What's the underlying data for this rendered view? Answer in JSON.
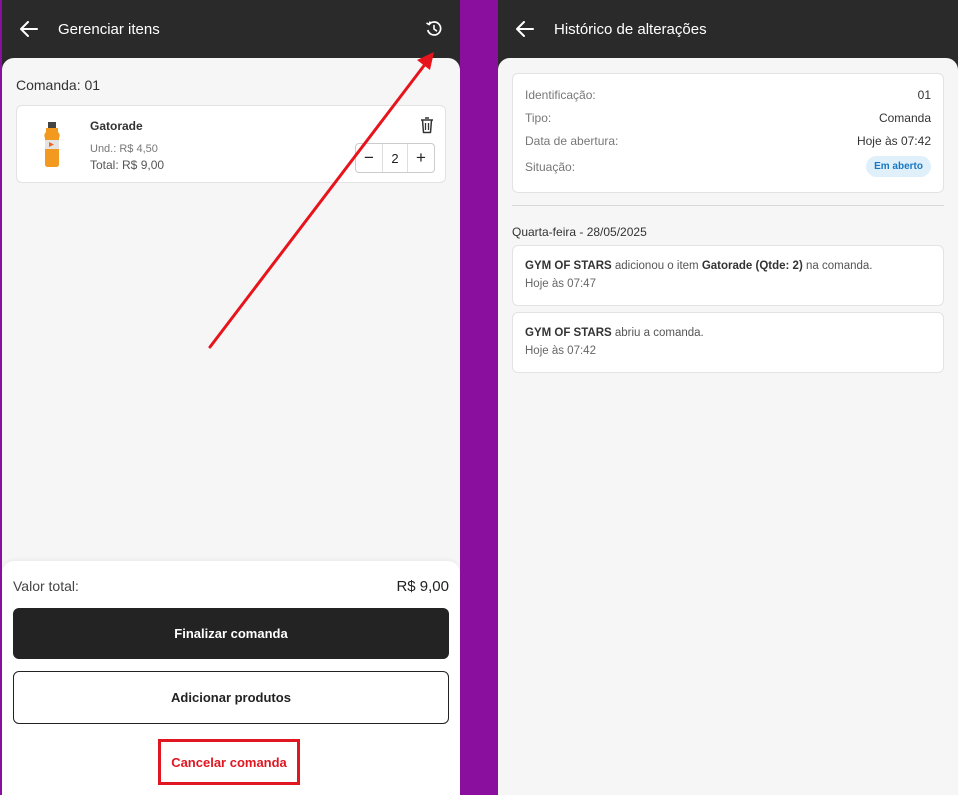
{
  "left": {
    "header": {
      "title": "Gerenciar itens"
    },
    "comanda_label": "Comanda: 01",
    "item": {
      "name": "Gatorade",
      "unit_price": "Und.: R$ 4,50",
      "total": "Total: R$ 9,00",
      "quantity": "2",
      "minus": "−",
      "plus": "+"
    },
    "footer": {
      "total_label": "Valor total:",
      "total_value": "R$ 9,00",
      "finalize_label": "Finalizar comanda",
      "add_label": "Adicionar produtos",
      "cancel_label": "Cancelar comanda"
    }
  },
  "right": {
    "header": {
      "title": "Histórico de alterações"
    },
    "info": [
      {
        "key": "Identificação:",
        "value": "01"
      },
      {
        "key": "Tipo:",
        "value": "Comanda"
      },
      {
        "key": "Data de abertura:",
        "value": "Hoje às 07:42"
      },
      {
        "key": "Situação:",
        "value": "Em aberto"
      }
    ],
    "date_group": "Quarta-feira - 28/05/2025",
    "logs": [
      {
        "actor": "GYM OF STARS",
        "pre": " adicionou o item ",
        "item": "Gatorade (Qtde: 2)",
        "post": " na comanda.",
        "time": "Hoje às 07:47"
      },
      {
        "actor": "GYM OF STARS",
        "pre": " abriu a comanda.",
        "item": "",
        "post": "",
        "time": "Hoje às 07:42"
      }
    ]
  },
  "colors": {
    "background": "#8b0f9f",
    "header": "#2a2a2a",
    "primary_button": "#232323",
    "cancel": "#e01621",
    "annotation_arrow": "#e8141c",
    "badge_bg": "#dff0fb",
    "badge_text": "#1a78c2"
  },
  "icons": {
    "back": "arrow-left-icon",
    "history": "history-icon",
    "delete": "trash-icon",
    "product": "gatorade-bottle-image"
  }
}
